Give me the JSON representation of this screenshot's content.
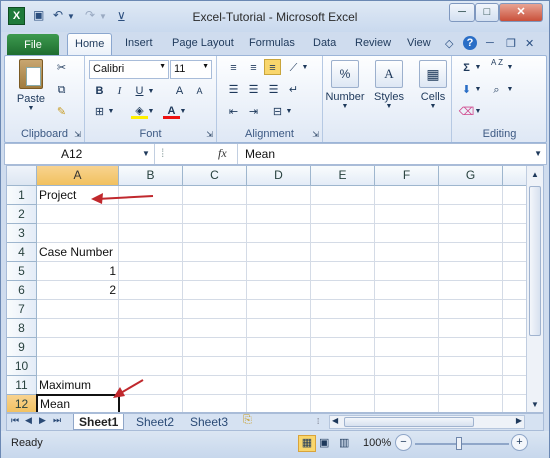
{
  "window": {
    "title": "Excel-Tutorial - Microsoft Excel",
    "app_icon_letter": "X",
    "controls": {
      "help_min": "▲",
      "minimize": "─",
      "maximize": "□",
      "close": "✕"
    }
  },
  "quick_access": {
    "save": "💾",
    "undo": "↶",
    "redo": "↷"
  },
  "ribbon_tabs": {
    "file": "File",
    "items": [
      "Home",
      "Insert",
      "Page Layout",
      "Formulas",
      "Data",
      "Review",
      "View"
    ]
  },
  "ribbon": {
    "clipboard": {
      "label": "Clipboard",
      "paste": "Paste"
    },
    "font": {
      "label": "Font",
      "font_name": "Calibri",
      "font_size": "11",
      "bold": "B",
      "italic": "I",
      "underline": "U",
      "grow": "A",
      "shrink": "A",
      "font_color_letter": "A"
    },
    "alignment": {
      "label": "Alignment"
    },
    "number": {
      "label": "Number",
      "symbol": "%"
    },
    "styles": {
      "label": "Styles",
      "symbol": "A"
    },
    "cells": {
      "label": "Cells"
    },
    "editing": {
      "label": "Editing",
      "sum": "Σ",
      "sort": "A Z"
    }
  },
  "formula_bar": {
    "name_box": "A12",
    "fx": "fx",
    "value": "Mean"
  },
  "columns": [
    "A",
    "B",
    "C",
    "D",
    "E",
    "F",
    "G"
  ],
  "rows": [
    "1",
    "2",
    "3",
    "4",
    "5",
    "6",
    "7",
    "8",
    "9",
    "10",
    "11",
    "12"
  ],
  "cells": {
    "A1": "Project",
    "A4": "Case Number",
    "A5": "1",
    "A6": "2",
    "A11": "Maximum",
    "A12": "Mean"
  },
  "sheet_tabs": [
    "Sheet1",
    "Sheet2",
    "Sheet3"
  ],
  "status": {
    "ready": "Ready",
    "zoom": "100%"
  },
  "colors": {
    "accent": "#1d6b2e",
    "arrow": "#c0282d",
    "selection": "#f1c15f"
  }
}
